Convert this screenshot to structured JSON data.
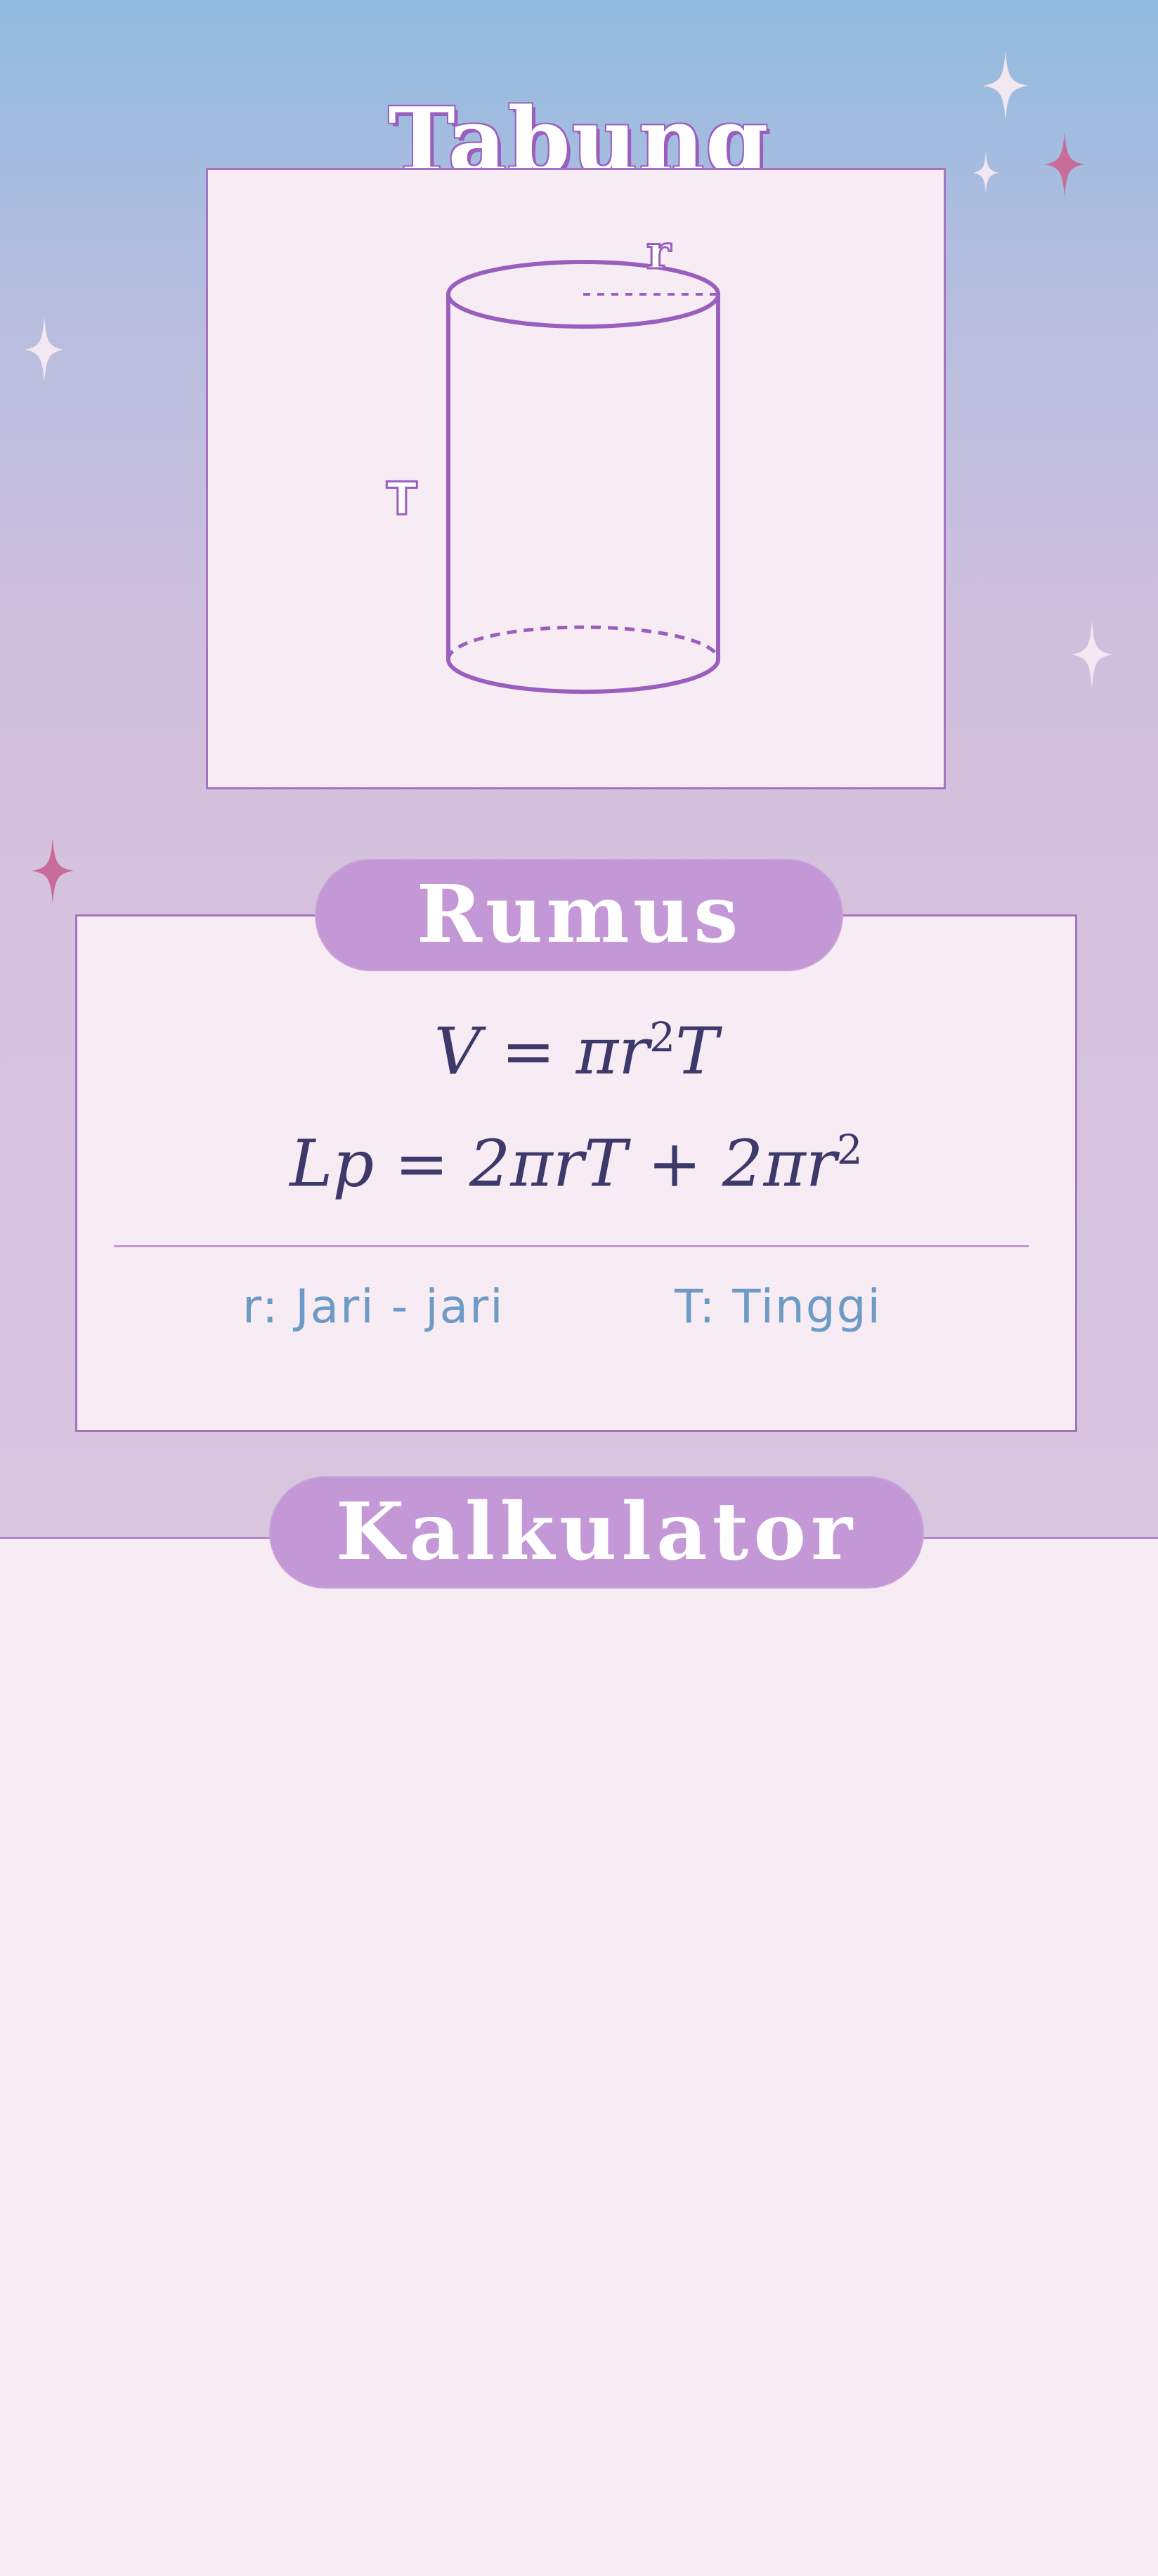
{
  "page": {
    "title": "Tabung"
  },
  "figure": {
    "radius_label": "r",
    "height_label": "T"
  },
  "rumus": {
    "heading": "Rumus",
    "volume_formula": {
      "lhs": "V",
      "eq": " = ",
      "pi": "π",
      "r": "r",
      "exp": "2",
      "t": "T"
    },
    "surface_formula": {
      "lhs": "Lp",
      "eq": " = ",
      "part1": "2πrT",
      "plus": " + ",
      "part2": "2πr",
      "exp": "2"
    },
    "legend_r": "r: Jari - jari",
    "legend_t": "T: Tinggi"
  },
  "kalkulator": {
    "heading": "Kalkulator"
  },
  "colors": {
    "accent": "#a672c2",
    "pill": "#c497d7",
    "formula_text": "#3d3a6b",
    "legend_text": "#6e9bc6",
    "card_bg": "#f7ecf3",
    "sparkle_light": "#f3e7f1",
    "sparkle_pink": "#c86c9a"
  }
}
